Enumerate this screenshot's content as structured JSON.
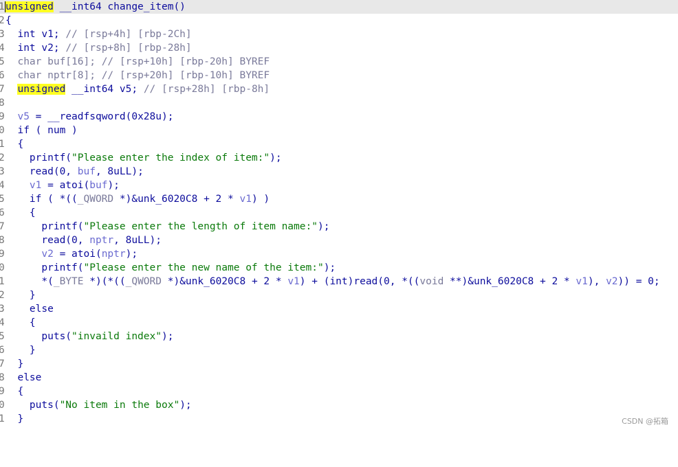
{
  "lines": [
    "1",
    "2",
    "3",
    "4",
    "5",
    "6",
    "7",
    "8",
    "9",
    "0",
    "1",
    "2",
    "3",
    "4",
    "5",
    "6",
    "7",
    "8",
    "9",
    "0",
    "1",
    "2",
    "3",
    "4",
    "5",
    "6",
    "7",
    "8",
    "9",
    "0",
    "1"
  ],
  "watermark": "CSDN @拓箱",
  "colors": {
    "keyword_highlight": "#ffff22",
    "string": "#0b7a0b",
    "comment": "#7a7a9a",
    "variable": "#6a6ad0"
  }
}
